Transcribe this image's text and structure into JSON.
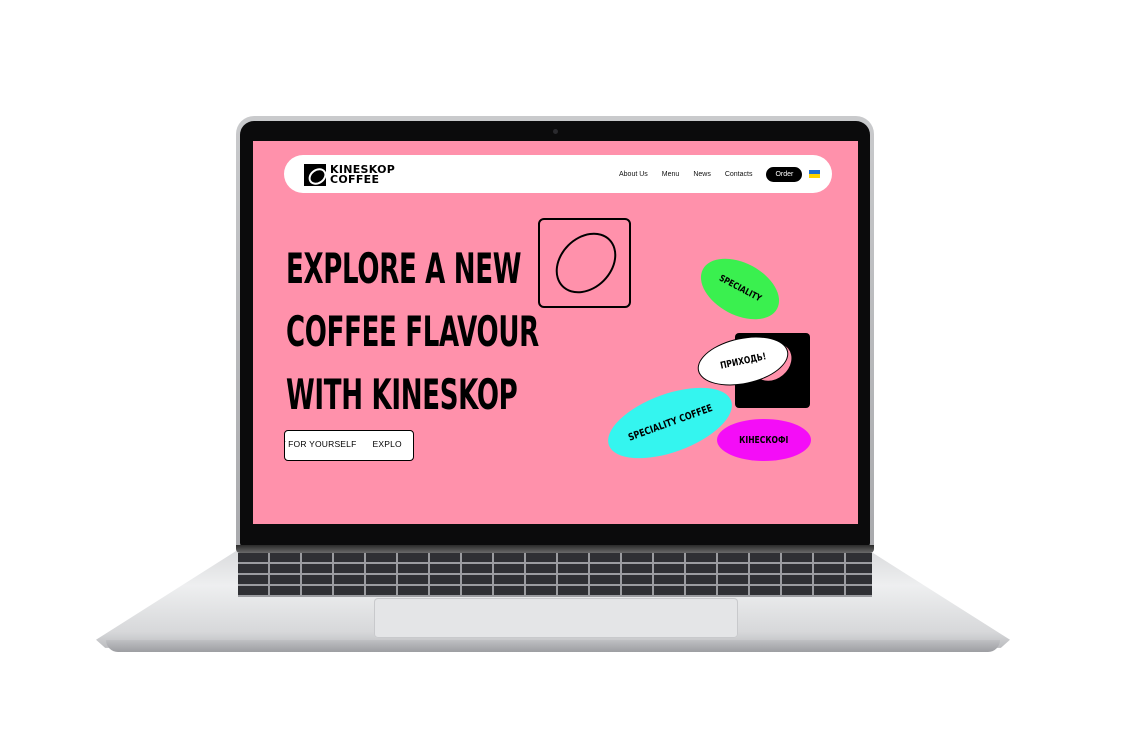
{
  "brand": {
    "logo_line1": "KINESKOP",
    "logo_line2": "COFFEE"
  },
  "nav": {
    "links": [
      "About Us",
      "Menu",
      "News",
      "Contacts"
    ],
    "order_label": "Order",
    "language_flag": "ukraine-flag-icon"
  },
  "hero": {
    "headline_line1": "EXPLORE A NEW",
    "headline_line2": "COFFEE FLAVOUR",
    "headline_line3": "WITH KINESKOP",
    "marquee_visible_start": "RE IT FOR YOURSELF",
    "marquee_visible_end": "EXPLO"
  },
  "stickers": {
    "green": "SPECIALITY",
    "white": "ПРИХОДЬ!",
    "cyan": "SPECIALITY COFFEE",
    "magenta": "КІНЕСКОФІ"
  },
  "colors": {
    "background": "#ff91ab",
    "sticker_green": "#3af04f",
    "sticker_cyan": "#34f5ef",
    "sticker_magenta": "#f40df7",
    "flag_blue": "#1f6fd1",
    "flag_yellow": "#ffd500"
  }
}
